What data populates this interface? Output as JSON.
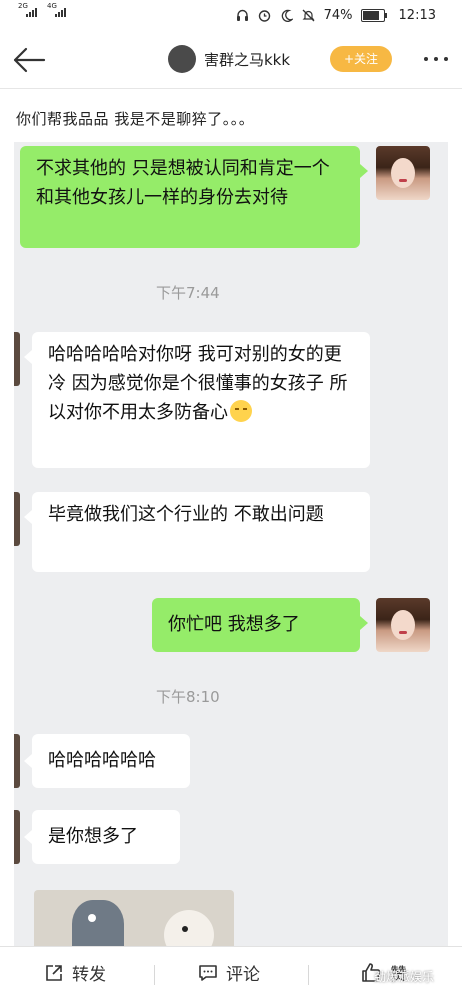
{
  "status_bar": {
    "network_1": "2G",
    "network_2": "4G",
    "battery_percent": "74%",
    "time": "12:13"
  },
  "header": {
    "username": "害群之马kkk",
    "follow_label": "+关注"
  },
  "post": {
    "caption": "你们帮我品品 我是不是聊猝了。。。"
  },
  "chat": {
    "messages": [
      {
        "side": "right",
        "text": "不求其他的 只是想被认同和肯定一个和其他女孩儿一样的身份去对待"
      },
      {
        "type": "time",
        "text": "下午7:44"
      },
      {
        "side": "left",
        "text": "哈哈哈哈哈对你呀 我可对别的女的更冷 因为感觉你是个很懂事的女孩子 所以对你不用太多防备心"
      },
      {
        "side": "left",
        "text": "毕竟做我们这个行业的 不敢出问题"
      },
      {
        "side": "right",
        "text": "你忙吧 我想多了"
      },
      {
        "type": "time",
        "text": "下午8:10"
      },
      {
        "side": "left",
        "text": "哈哈哈哈哈哈"
      },
      {
        "side": "left",
        "text": "是你想多了"
      }
    ]
  },
  "actions": {
    "repost": "转发",
    "comment": "评论",
    "like": "赞"
  },
  "watermark": "劲爆派娱乐",
  "colors": {
    "follow": "#f7b843",
    "green_bubble": "#95ec69",
    "chat_bg": "#edeef0"
  }
}
